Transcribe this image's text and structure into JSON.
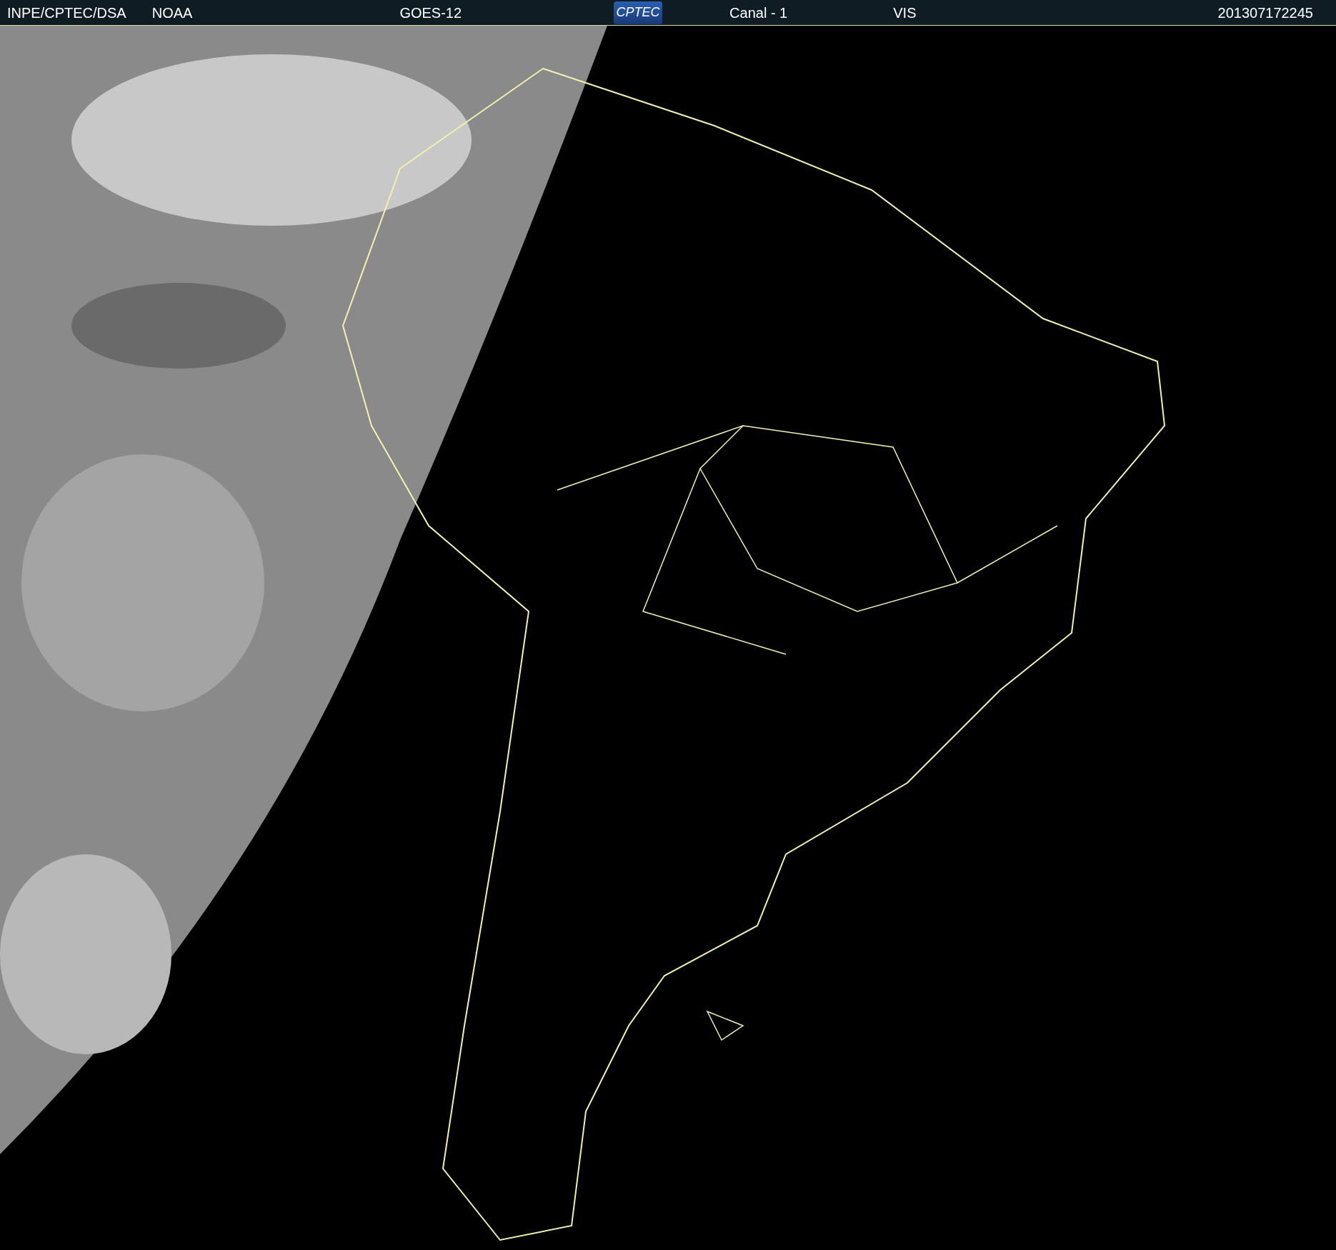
{
  "header": {
    "source": "INPE/CPTEC/DSA",
    "agency": "NOAA",
    "satellite": "GOES-12",
    "logo": "CPTEC",
    "channel": "Canal - 1",
    "band": "VIS",
    "timestamp": "201307172245"
  }
}
